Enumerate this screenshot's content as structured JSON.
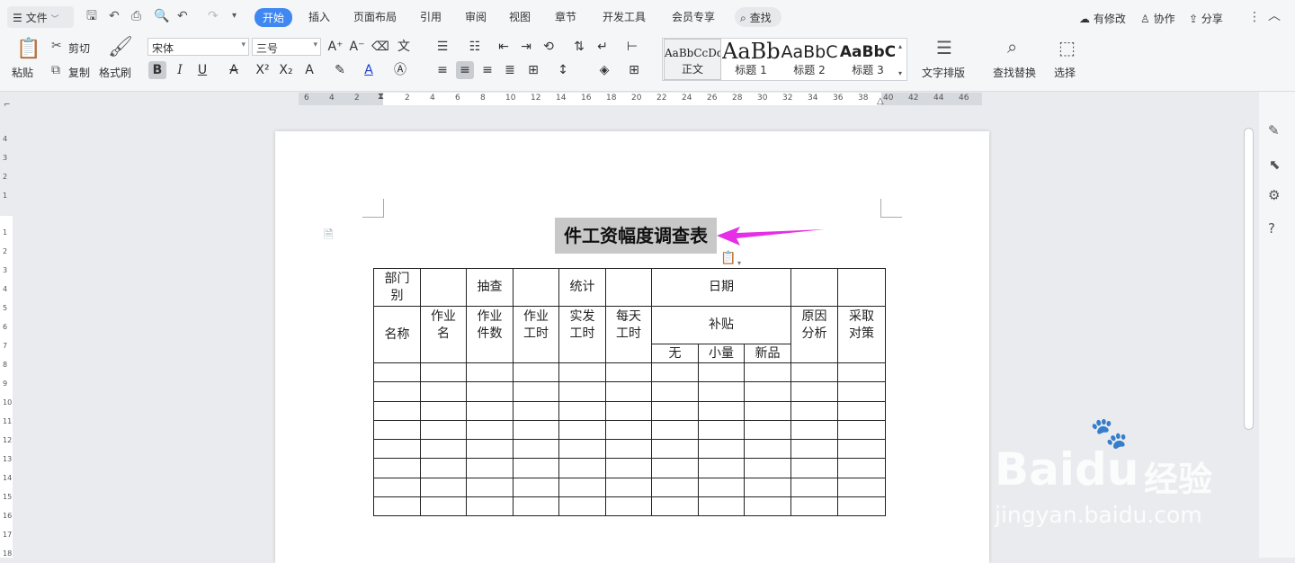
{
  "menu": {
    "file_label": "文件",
    "tabs": [
      "开始",
      "插入",
      "页面布局",
      "引用",
      "审阅",
      "视图",
      "章节",
      "开发工具",
      "会员专享"
    ],
    "active_tab": "开始",
    "search_label": "查找",
    "right": {
      "modified": "有修改",
      "collab": "协作",
      "share": "分享"
    }
  },
  "ribbon": {
    "paste": "粘贴",
    "cut": "剪切",
    "copy": "复制",
    "format_painter": "格式刷",
    "font_name": "宋体",
    "font_size": "三号",
    "styles": [
      {
        "preview": "AaBbCcDd",
        "label": "正文"
      },
      {
        "preview": "AaBb",
        "label": "标题 1"
      },
      {
        "preview": "AaBbC",
        "label": "标题 2"
      },
      {
        "preview": "AaBbC",
        "label": "标题 3"
      }
    ],
    "text_layout": "文字排版",
    "find_replace": "查找替换",
    "select": "选择"
  },
  "ruler": {
    "h_numbers": [
      "6",
      "4",
      "2",
      "2",
      "4",
      "6",
      "8",
      "10",
      "12",
      "14",
      "16",
      "18",
      "20",
      "22",
      "24",
      "26",
      "28",
      "30",
      "32",
      "34",
      "36",
      "38",
      "40",
      "42",
      "44",
      "46"
    ],
    "v_numbers": [
      "4",
      "3",
      "2",
      "1",
      "1",
      "2",
      "3",
      "4",
      "5",
      "6",
      "7",
      "8",
      "9",
      "10",
      "11",
      "12",
      "13",
      "14",
      "15",
      "16",
      "17",
      "18"
    ]
  },
  "document": {
    "title": "件工资幅度调查表",
    "table": {
      "row1": [
        "部门别",
        "",
        "抽查",
        "",
        "统计",
        "",
        "日期",
        "",
        ""
      ],
      "row2": [
        "名称",
        "作业名",
        "作业件数",
        "作业工时",
        "实发工时",
        "每天工时",
        "补贴",
        "原因分析",
        "采取对策"
      ],
      "row3_sub": [
        "无",
        "小量",
        "新品"
      ],
      "empty_rows": 8
    }
  },
  "watermark": {
    "brand": "Baidu",
    "suffix": "经验",
    "url": "jingyan.baidu.com"
  },
  "colors": {
    "accent": "#3f88f2",
    "arrow": "#e62ee6",
    "selection": "#c8c8c8"
  }
}
